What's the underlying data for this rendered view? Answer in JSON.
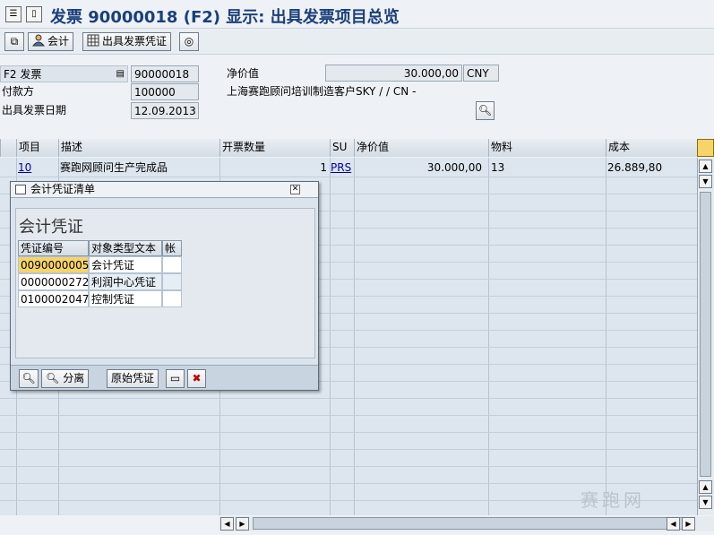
{
  "window": {
    "title": "发票 90000018  (F2) 显示: 出具发票项目总览"
  },
  "toolbar": {
    "accounting_label": "会计",
    "issue_invoice_voucher_label": "出具发票凭证"
  },
  "header": {
    "billing_type_label": "F2 发票",
    "billing_doc_number": "90000018",
    "payer_label": "付款方",
    "payer_value": "100000",
    "billing_date_label": "出具发票日期",
    "billing_date_value": "12.09.2013",
    "net_value_label": "净价值",
    "net_value": "30.000,00",
    "currency": "CNY",
    "customer_text": "上海赛跑顾问培训制造客户SKY / / CN -"
  },
  "grid": {
    "columns": [
      "项目",
      "描述",
      "开票数量",
      "SU",
      "净价值",
      "物料",
      "成本"
    ],
    "rows": [
      {
        "item": "10",
        "description": "赛跑网顾问生产完成品",
        "quantity": "1",
        "unit": "PRS",
        "net_value": "30.000,00",
        "material": "13",
        "cost": "26.889,80"
      }
    ]
  },
  "popup": {
    "title": "会计凭证清单",
    "heading": "会计凭证",
    "columns": [
      "凭证编号",
      "对象类型文本",
      "帐"
    ],
    "rows": [
      {
        "doc_number": "0090000005",
        "type_text": "会计凭证"
      },
      {
        "doc_number": "0000000272",
        "type_text": "利润中心凭证"
      },
      {
        "doc_number": "0100002047",
        "type_text": "控制凭证"
      }
    ],
    "buttons": {
      "split_label": "分离",
      "original_doc_label": "原始凭证"
    }
  },
  "watermark": {
    "text": "赛跑网"
  },
  "colors": {
    "title_blue": "#1b3f7a",
    "selection_yellow": "#f7d46a",
    "close_red": "#c00000"
  }
}
